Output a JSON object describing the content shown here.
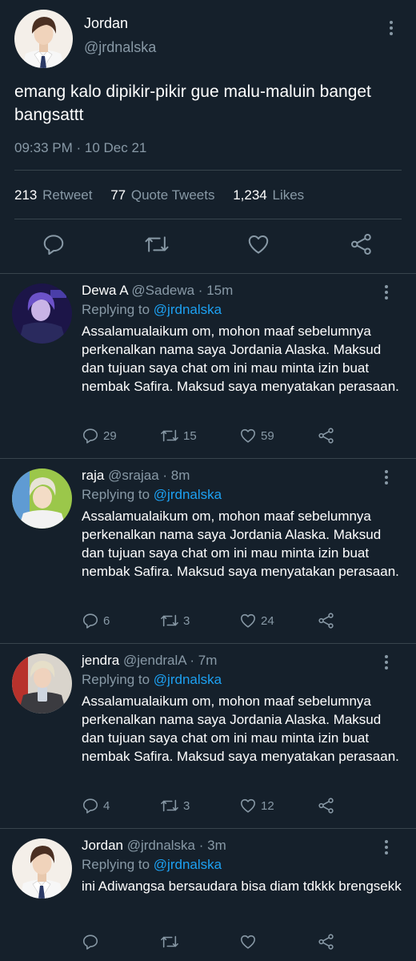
{
  "main_tweet": {
    "author_name": "Jordan",
    "author_handle": "@jrdnalska",
    "text": "emang kalo dipikir-pikir gue malu-maluin banget bangsattt",
    "timestamp": "09:33 PM · 10 Dec 21",
    "retweets_count": "213",
    "retweets_label": "Retweet",
    "quotes_count": "77",
    "quotes_label": "Quote Tweets",
    "likes_count": "1,234",
    "likes_label": "Likes",
    "icons": [
      "reply-icon",
      "retweet-icon",
      "like-icon",
      "share-icon",
      "more-icon"
    ]
  },
  "replies": [
    {
      "name": "Dewa A",
      "handle_time": "@Sadewa · 15m",
      "replying_prefix": "Replying to",
      "replying_to": "@jrdnalska",
      "text": "Assalamualaikum om, mohon maaf sebelumnya perkenalkan nama saya Jordania Alaska. Maksud dan tujuan saya chat om ini mau minta izin buat nembak Safira. Maksud saya menyatakan perasaan.",
      "reply_count": "29",
      "retweet_count": "15",
      "like_count": "59"
    },
    {
      "name": "raja",
      "handle_time": "@srajaa · 8m",
      "replying_prefix": "Replying to",
      "replying_to": "@jrdnalska",
      "text": "Assalamualaikum om, mohon maaf sebelumnya perkenalkan nama saya Jordania Alaska. Maksud dan tujuan saya chat om ini mau minta izin buat nembak Safira. Maksud saya menyatakan perasaan.",
      "reply_count": "6",
      "retweet_count": "3",
      "like_count": "24"
    },
    {
      "name": "jendra",
      "handle_time": "@jendralA · 7m",
      "replying_prefix": "Replying to",
      "replying_to": "@jrdnalska",
      "text": "Assalamualaikum om, mohon maaf sebelumnya perkenalkan nama saya Jordania Alaska. Maksud dan tujuan saya chat om ini mau minta izin buat nembak Safira. Maksud saya menyatakan perasaan.",
      "reply_count": "4",
      "retweet_count": "3",
      "like_count": "12"
    },
    {
      "name": "Jordan",
      "handle_time": "@jrdnalska · 3m",
      "replying_prefix": "Replying to",
      "replying_to": "@jrdnalska",
      "text": "ini Adiwangsa bersaudara bisa diam tdkkk brengsekk",
      "reply_count": "",
      "retweet_count": "",
      "like_count": ""
    }
  ],
  "colors": {
    "background": "#15202b",
    "divider": "#38444d",
    "muted_text": "#8899a6",
    "link": "#1da1f2"
  }
}
